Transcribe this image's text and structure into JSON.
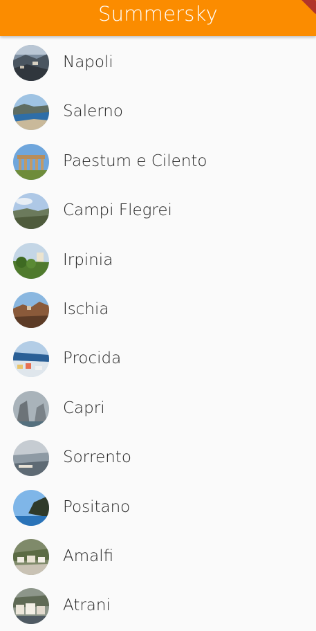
{
  "appbar": {
    "title": "Summersky",
    "color": "#fb8c00"
  },
  "places": [
    {
      "label": "Napoli",
      "icon": "napoli-photo"
    },
    {
      "label": "Salerno",
      "icon": "salerno-photo"
    },
    {
      "label": "Paestum e Cilento",
      "icon": "paestum-photo"
    },
    {
      "label": "Campi Flegrei",
      "icon": "campi-flegrei-photo"
    },
    {
      "label": "Irpinia",
      "icon": "irpinia-photo"
    },
    {
      "label": "Ischia",
      "icon": "ischia-photo"
    },
    {
      "label": "Procida",
      "icon": "procida-photo"
    },
    {
      "label": "Capri",
      "icon": "capri-photo"
    },
    {
      "label": "Sorrento",
      "icon": "sorrento-photo"
    },
    {
      "label": "Positano",
      "icon": "positano-photo"
    },
    {
      "label": "Amalfi",
      "icon": "amalfi-photo"
    },
    {
      "label": "Atrani",
      "icon": "atrani-photo"
    }
  ]
}
